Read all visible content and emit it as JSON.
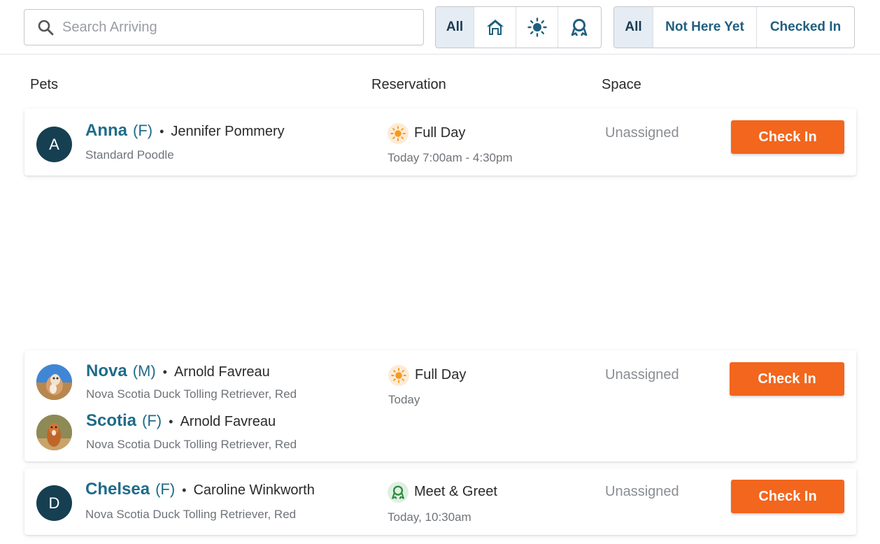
{
  "search": {
    "placeholder": "Search Arriving",
    "value": ""
  },
  "type_filter": {
    "all_label": "All",
    "options": [
      {
        "icon": "house-icon"
      },
      {
        "icon": "sun-icon"
      },
      {
        "icon": "meet-greet-icon"
      }
    ]
  },
  "status_filter": {
    "all_label": "All",
    "not_here_label": "Not Here Yet",
    "checked_in_label": "Checked In"
  },
  "columns": {
    "pets": "Pets",
    "reservation": "Reservation",
    "space": "Space"
  },
  "colors": {
    "accent": "#1f6b8a",
    "button": "#f2661d",
    "avatar_bg": "#163f52"
  },
  "rows": [
    {
      "pets": [
        {
          "avatar": "A",
          "name": "Anna",
          "sex": "(F)",
          "owner": "Jennifer Pommery",
          "breed": "Standard Poodle"
        }
      ],
      "reservation": {
        "icon": "sun-icon",
        "type": "Full Day",
        "time": "Today 7:00am - 4:30pm"
      },
      "space": "Unassigned",
      "button": "Check In"
    },
    {
      "pets": [
        {
          "avatar": "photo",
          "name": "Nova",
          "sex": "(M)",
          "owner": "Arnold Favreau",
          "breed": "Nova Scotia Duck Tolling Retriever, Red"
        },
        {
          "avatar": "photo",
          "name": "Scotia",
          "sex": "(F)",
          "owner": "Arnold Favreau",
          "breed": "Nova Scotia Duck Tolling Retriever, Red"
        }
      ],
      "reservation": {
        "icon": "sun-icon",
        "type": "Full Day",
        "time": "Today"
      },
      "space": "Unassigned",
      "button": "Check In"
    },
    {
      "pets": [
        {
          "avatar": "D",
          "name": "Chelsea",
          "sex": "(F)",
          "owner": "Caroline Winkworth",
          "breed": "Nova Scotia Duck Tolling Retriever, Red"
        }
      ],
      "reservation": {
        "icon": "meet-greet-icon",
        "type": "Meet & Greet",
        "time": "Today, 10:30am"
      },
      "space": "Unassigned",
      "button": "Check In"
    }
  ]
}
